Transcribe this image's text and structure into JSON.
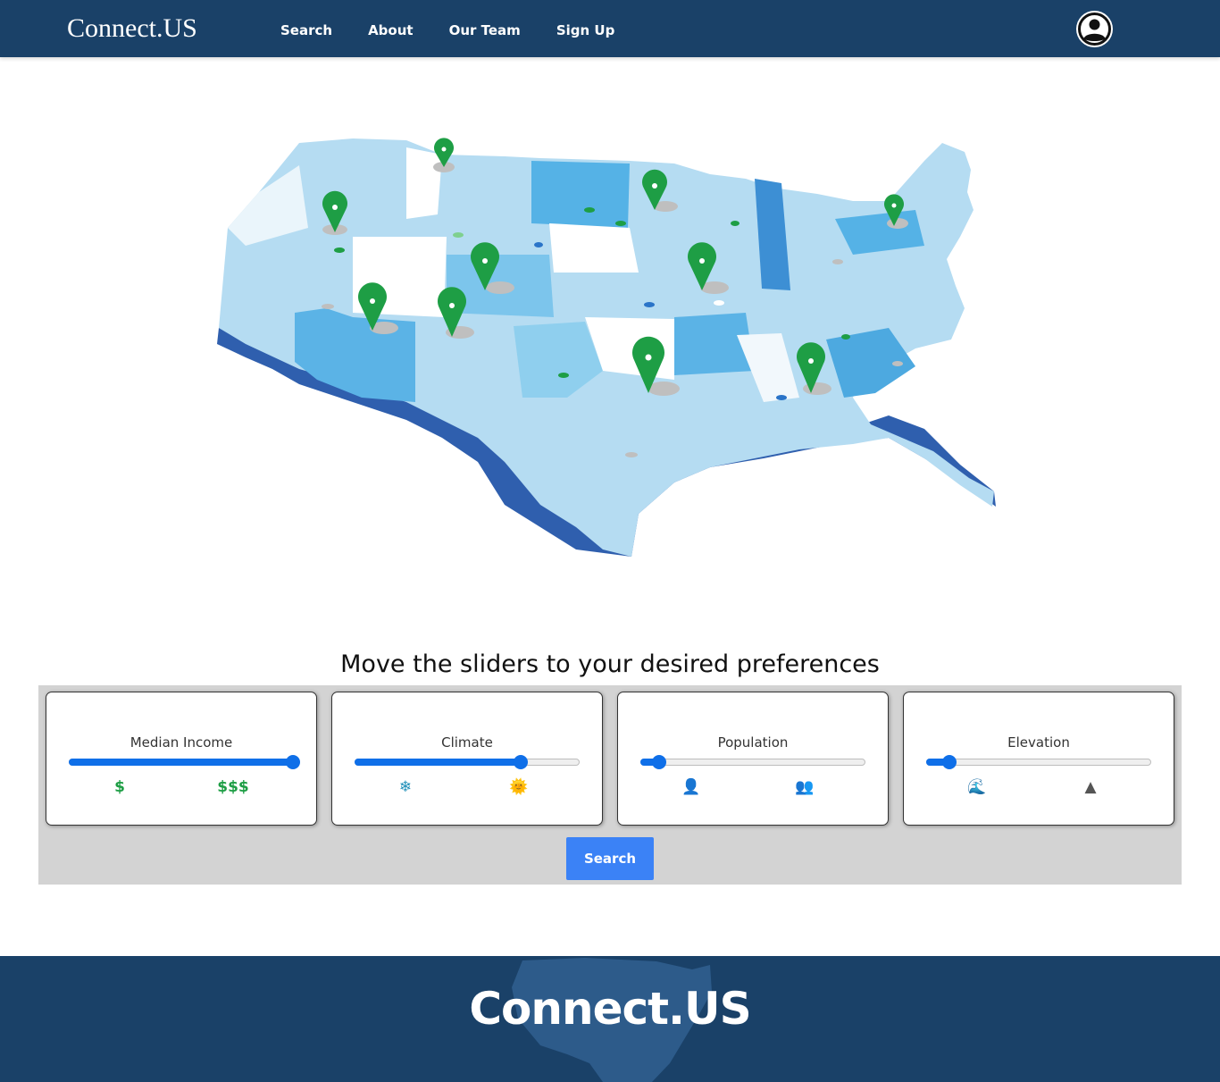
{
  "nav": {
    "brand": "Connect.US",
    "links": [
      "Search",
      "About",
      "Our Team",
      "Sign Up"
    ],
    "profile_icon": "user-circle-icon"
  },
  "hero": {
    "image": "us-map-with-pins-illustration"
  },
  "preferences": {
    "prompt": "Move the sliders to your desired preferences",
    "sliders": [
      {
        "label": "Median Income",
        "value": 1.0,
        "left_icon": "$",
        "right_icon": "$$$",
        "left_icon_name": "dollar-icon",
        "right_icon_name": "triple-dollar-icon"
      },
      {
        "label": "Climate",
        "value": 0.74,
        "left_icon": "❄",
        "right_icon": "🌞",
        "left_icon_name": "snowflake-icon",
        "right_icon_name": "sun-icon"
      },
      {
        "label": "Population",
        "value": 0.08,
        "left_icon": "👤",
        "right_icon": "👥",
        "left_icon_name": "person-icon",
        "right_icon_name": "people-icon"
      },
      {
        "label": "Elevation",
        "value": 0.1,
        "left_icon": "🌊",
        "right_icon": "▲",
        "left_icon_name": "wave-icon",
        "right_icon_name": "mountain-icon"
      }
    ],
    "search_button": "Search"
  },
  "footer": {
    "logo": "Connect.US"
  },
  "colors": {
    "navy": "#1a4168",
    "slider_blue": "#0f6fe8",
    "button_blue": "#3b82f6",
    "panel_gray": "#d3d3d3"
  }
}
